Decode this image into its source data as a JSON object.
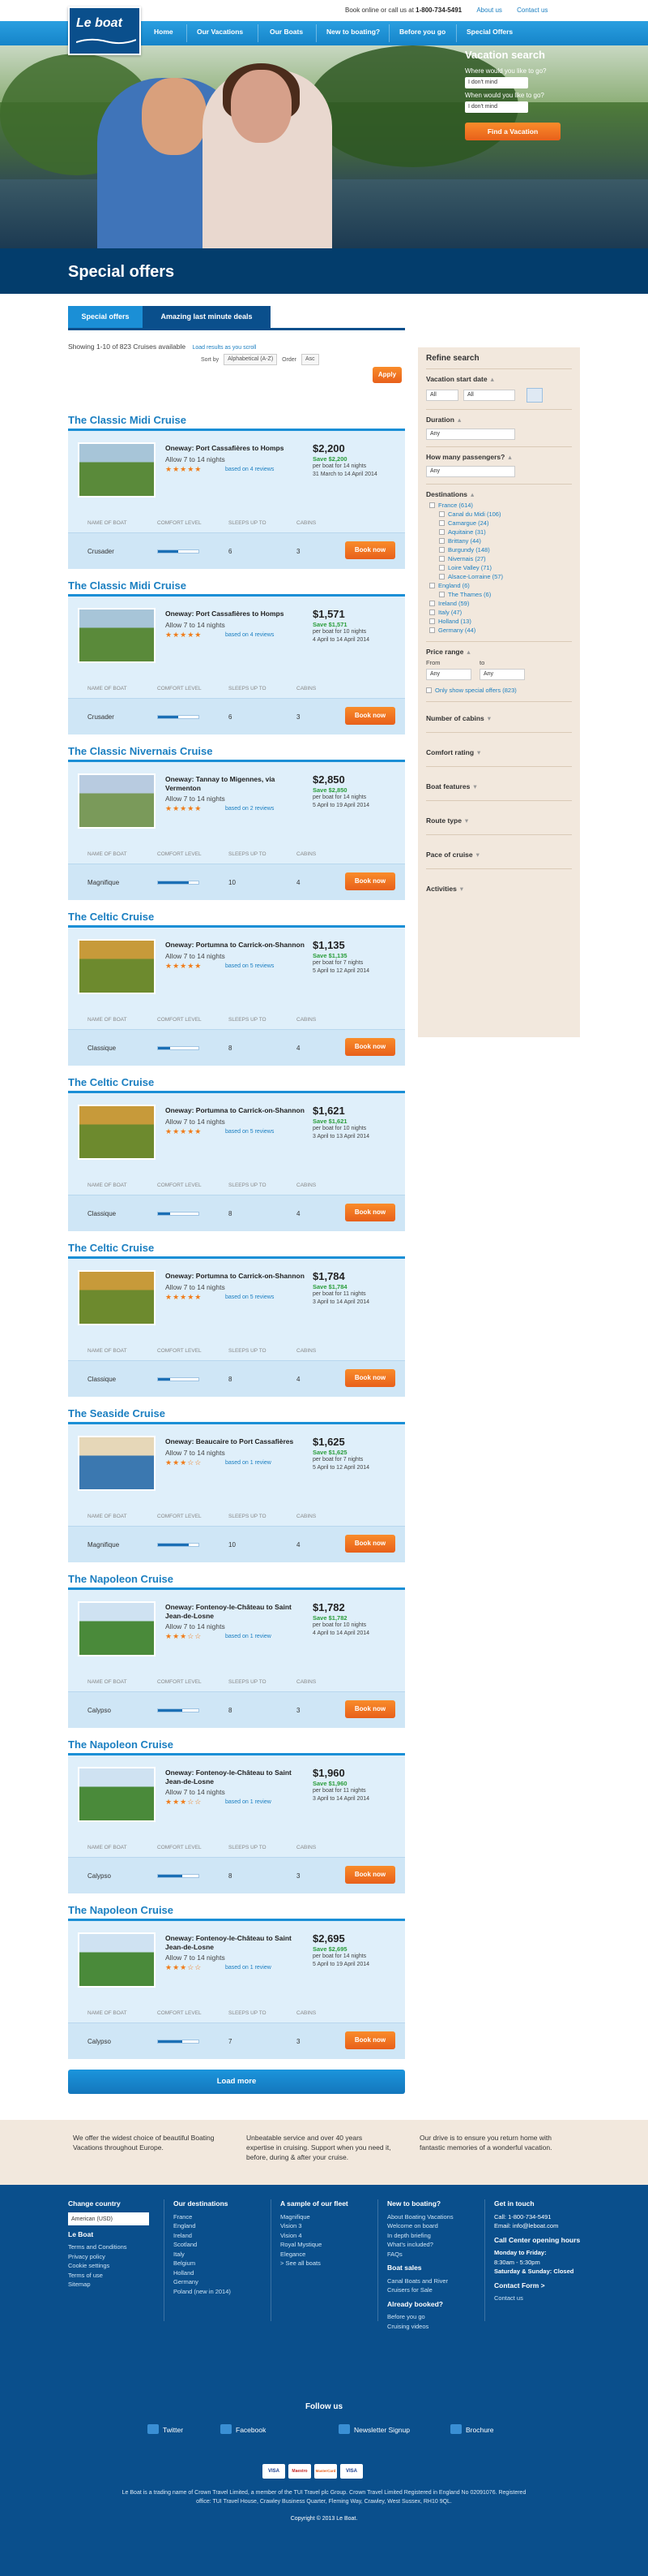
{
  "brand": {
    "logo_text": "Le boat"
  },
  "utility": {
    "call_text": "Book online or call us at",
    "phone": "1-800-734-5491",
    "about": "About us",
    "contact": "Contact us"
  },
  "nav": [
    "Home",
    "Our Vacations",
    "Our Boats",
    "New to boating?",
    "Before you go",
    "Special Offers"
  ],
  "vacation_search": {
    "title": "Vacation search",
    "q1": "Where would you like to go?",
    "q1_value": "I don't mind",
    "q2": "When would you like to go?",
    "q2_value": "I don't mind",
    "button": "Find a Vacation"
  },
  "page_title": "Special offers",
  "tabs": [
    "Special offers",
    "Amazing last minute deals"
  ],
  "showing": {
    "text": "Showing 1-10 of 823 Cruises available",
    "link": "Load results as you scroll"
  },
  "sort": {
    "sort_by_label": "Sort by",
    "sort_by_value": "Alphabetical (A-Z)",
    "order_label": "Order",
    "order_value": "Asc",
    "apply": "Apply"
  },
  "refine": {
    "title": "Refine search",
    "start_date": "Vacation start date",
    "start_day": "All",
    "start_month": "All",
    "duration": "Duration",
    "duration_value": "Any",
    "passengers": "How many passengers?",
    "passengers_value": "Any",
    "destinations_label": "Destinations",
    "destinations": [
      "France (614)",
      "Canal du Midi (106)",
      "Camargue (24)",
      "Aquitaine (31)",
      "Brittany (44)",
      "Burgundy (148)",
      "Nivernais (27)",
      "Loire Valley (71)",
      "Alsace-Lorraine (57)",
      "England (6)",
      "The Thames (6)",
      "Ireland (59)",
      "Italy (47)",
      "Holland (13)",
      "Germany (44)"
    ],
    "price_range": "Price range",
    "price_from": "From",
    "price_to": "to",
    "price_from_value": "Any",
    "price_to_value": "Any",
    "special_only": "Only show special offers (823)",
    "facets": [
      "Number of cabins",
      "Comfort rating",
      "Boat features",
      "Route type",
      "Pace of cruise",
      "Activities"
    ]
  },
  "col_labels": {
    "boat": "NAME OF BOAT",
    "comfort": "COMFORT LEVEL",
    "sleeps": "SLEEPS UP TO",
    "cabins": "CABINS",
    "book": "Book now"
  },
  "cruises": [
    {
      "title": "The Classic Midi Cruise",
      "route": "Oneway: Port Cassafières to Homps",
      "allow": "Allow 7 to 14 nights",
      "stars": 5,
      "reviews": "based on 4 reviews",
      "price": "$2,200",
      "save": "Save $2,200",
      "per": "per boat for 14 nights",
      "dates": "31 March to 14 April 2014",
      "boat": "Crusader",
      "comfort": 0.5,
      "sleeps": "6",
      "cabins": "3"
    },
    {
      "title": "The Classic Midi Cruise",
      "route": "Oneway: Port Cassafières to Homps",
      "allow": "Allow 7 to 14 nights",
      "stars": 5,
      "reviews": "based on 4 reviews",
      "price": "$1,571",
      "save": "Save $1,571",
      "per": "per boat for 10 nights",
      "dates": "4 April to 14 April 2014",
      "boat": "Crusader",
      "comfort": 0.5,
      "sleeps": "6",
      "cabins": "3"
    },
    {
      "title": "The Classic Nivernais Cruise",
      "route": "Oneway: Tannay to Migennes, via Vermenton",
      "allow": "Allow 7 to 14 nights",
      "stars": 5,
      "reviews": "based on 2 reviews",
      "price": "$2,850",
      "save": "Save $2,850",
      "per": "per boat for 14 nights",
      "dates": "5 April to 19 April 2014",
      "boat": "Magnifique",
      "comfort": 0.75,
      "sleeps": "10",
      "cabins": "4"
    },
    {
      "title": "The Celtic Cruise",
      "route": "Oneway: Portumna to Carrick-on-Shannon",
      "allow": "Allow 7 to 14 nights",
      "stars": 5,
      "reviews": "based on 5 reviews",
      "price": "$1,135",
      "save": "Save $1,135",
      "per": "per boat for 7 nights",
      "dates": "5 April to 12 April 2014",
      "boat": "Classique",
      "comfort": 0.3,
      "sleeps": "8",
      "cabins": "4"
    },
    {
      "title": "The Celtic Cruise",
      "route": "Oneway: Portumna to Carrick-on-Shannon",
      "allow": "Allow 7 to 14 nights",
      "stars": 5,
      "reviews": "based on 5 reviews",
      "price": "$1,621",
      "save": "Save $1,621",
      "per": "per boat for 10 nights",
      "dates": "3 April to 13 April 2014",
      "boat": "Classique",
      "comfort": 0.3,
      "sleeps": "8",
      "cabins": "4"
    },
    {
      "title": "The Celtic Cruise",
      "route": "Oneway: Portumna to Carrick-on-Shannon",
      "allow": "Allow 7 to 14 nights",
      "stars": 5,
      "reviews": "based on 5 reviews",
      "price": "$1,784",
      "save": "Save $1,784",
      "per": "per boat for 11 nights",
      "dates": "3 April to 14 April 2014",
      "boat": "Classique",
      "comfort": 0.3,
      "sleeps": "8",
      "cabins": "4"
    },
    {
      "title": "The Seaside Cruise",
      "route": "Oneway: Beaucaire to Port Cassafières",
      "allow": "Allow 7 to 14 nights",
      "stars": 3,
      "reviews": "based on 1 review",
      "price": "$1,625",
      "save": "Save $1,625",
      "per": "per boat for 7 nights",
      "dates": "5 April to 12 April 2014",
      "boat": "Magnifique",
      "comfort": 0.75,
      "sleeps": "10",
      "cabins": "4"
    },
    {
      "title": "The Napoleon Cruise",
      "route": "Oneway: Fontenoy-le-Château to Saint Jean-de-Losne",
      "allow": "Allow 7 to 14 nights",
      "stars": 3,
      "reviews": "based on 1 review",
      "price": "$1,782",
      "save": "Save $1,782",
      "per": "per boat for 10 nights",
      "dates": "4 April to 14 April 2014",
      "boat": "Calypso",
      "comfort": 0.6,
      "sleeps": "8",
      "cabins": "3"
    },
    {
      "title": "The Napoleon Cruise",
      "route": "Oneway: Fontenoy-le-Château to Saint Jean-de-Losne",
      "allow": "Allow 7 to 14 nights",
      "stars": 3,
      "reviews": "based on 1 review",
      "price": "$1,960",
      "save": "Save $1,960",
      "per": "per boat for 11 nights",
      "dates": "3 April to 14 April 2014",
      "boat": "Calypso",
      "comfort": 0.6,
      "sleeps": "8",
      "cabins": "3"
    },
    {
      "title": "The Napoleon Cruise",
      "route": "Oneway: Fontenoy-le-Château to Saint Jean-de-Losne",
      "allow": "Allow 7 to 14 nights",
      "stars": 3,
      "reviews": "based on 1 review",
      "price": "$2,695",
      "save": "Save $2,695",
      "per": "per boat for 14 nights",
      "dates": "5 April to 19 April 2014",
      "boat": "Calypso",
      "comfort": 0.6,
      "sleeps": "7",
      "cabins": "3"
    }
  ],
  "load_more": "Load more",
  "usps": [
    "We offer the widest choice of beautiful Boating Vacations throughout Europe.",
    "Unbeatable service and over 40 years expertise in cruising. Support when you need it, before, during & after your cruise.",
    "Our drive is to ensure you return home with fantastic memories of a wonderful vacation."
  ],
  "footer": {
    "change_country": "Change country",
    "country_value": "American (USD)",
    "leboat_title": "Le Boat",
    "leboat_links": [
      "Terms and Conditions",
      "Privacy policy",
      "Cookie settings",
      "Terms of use",
      "Sitemap"
    ],
    "dest_title": "Our destinations",
    "dest_links": [
      "France",
      "England",
      "Ireland",
      "Scotland",
      "Italy",
      "Belgium",
      "Holland",
      "Germany",
      "Poland (new in 2014)"
    ],
    "fleet_title": "A sample of our fleet",
    "fleet_links": [
      "Magnifique",
      "Vision 3",
      "Vision 4",
      "Royal Mystique",
      "Elegance",
      "> See all boats"
    ],
    "new_title": "New to boating?",
    "new_links": [
      "About Boating Vacations",
      "Welcome on board",
      "In depth briefing",
      "What's included?",
      "FAQs"
    ],
    "sales_title": "Boat sales",
    "sales_links": [
      "Canal Boats and River",
      "Cruisers for Sale"
    ],
    "booked_title": "Already booked?",
    "booked_links": [
      "Before you go",
      "Cruising videos"
    ],
    "touch_title": "Get in touch",
    "touch_call": "Call: 1-800-734-5491",
    "touch_email": "Email: info@leboat.com",
    "hours_title": "Call Center opening hours",
    "hours_1": "Monday to Friday:",
    "hours_2": "8:30am - 5:30pm",
    "hours_3": "Saturday & Sunday: Closed",
    "form_title": "Contact Form >",
    "contact_us": "Contact us"
  },
  "follow": {
    "title": "Follow us",
    "twitter": "Twitter",
    "facebook": "Facebook",
    "newsletter": "Newsletter Signup",
    "brochure": "Brochure"
  },
  "payment_cards": [
    "VISA",
    "Maestro",
    "MasterCard",
    "VISA"
  ],
  "legal": "Le Boat is a trading name of Crown Travel Limited, a member of the TUI Travel plc Group. Crown Travel Limited Registered in England No 02091076. Registered office: TUI Travel House, Crawley Business Quarter, Fleming Way, Crawley, West Sussex, RH10 9QL.",
  "copyright": "Copyright © 2013 Le Boat."
}
